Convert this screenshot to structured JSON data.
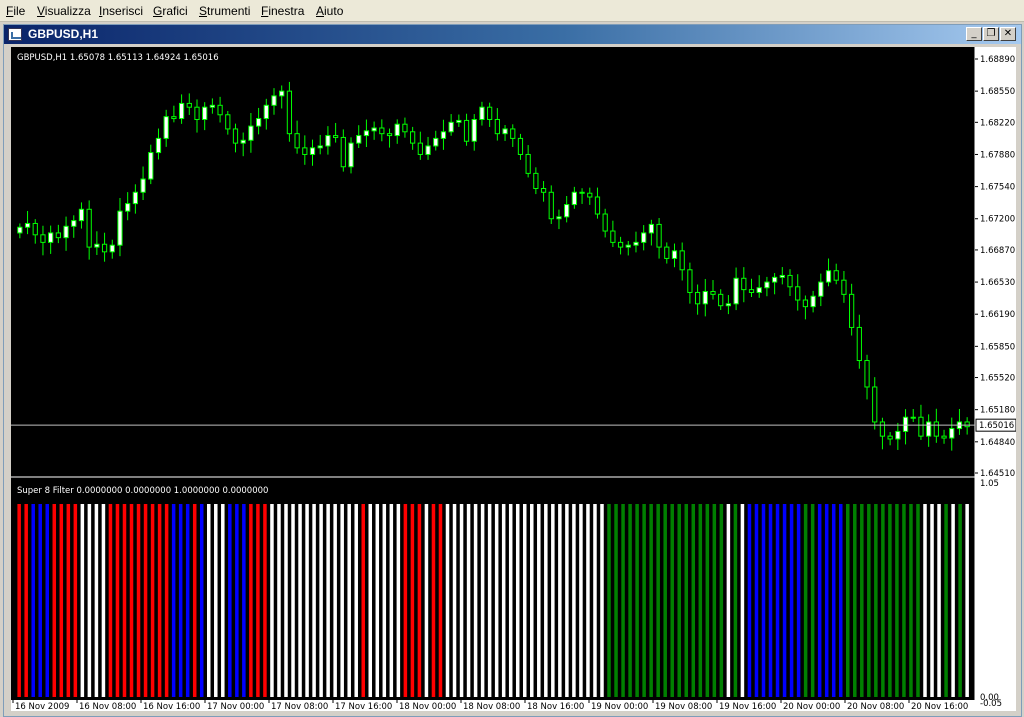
{
  "menu": {
    "items": [
      {
        "label": "File",
        "underline": "F",
        "rest": "ile"
      },
      {
        "label": "Visualizza",
        "underline": "V",
        "rest": "isualizza"
      },
      {
        "label": "Inserisci",
        "underline": "I",
        "rest": "nserisci"
      },
      {
        "label": "Grafici",
        "underline": "G",
        "rest": "rafici"
      },
      {
        "label": "Strumenti",
        "underline": "S",
        "rest": "trumenti"
      },
      {
        "label": "Finestra",
        "underline": "F",
        "rest": "inestra"
      },
      {
        "label": "Aiuto",
        "underline": "A",
        "rest": "iuto"
      }
    ]
  },
  "window": {
    "title": "GBPUSD,H1",
    "minimize_glyph": "_",
    "restore_glyph": "❐",
    "close_glyph": "✕"
  },
  "colors": {
    "chart_bg": "#000000",
    "candle_bull": "#ffffff",
    "candle_bear": "#000000",
    "candle_outline": "#00ff00",
    "ind_red": "#ff0000",
    "ind_blue": "#0000ff",
    "ind_white": "#ffffff",
    "ind_green": "#008000",
    "price_line": "#c0c0c0",
    "axis_panel": "#ffffff"
  },
  "chart_data": [
    {
      "type": "candlestick",
      "title": "GBPUSD,H1",
      "ohlc_header": "GBPUSD,H1  1.65078 1.65113 1.64924 1.65016",
      "y_ticks": [
        "1.68890",
        "1.68550",
        "1.68220",
        "1.67880",
        "1.67540",
        "1.67200",
        "1.66870",
        "1.66530",
        "1.66190",
        "1.65850",
        "1.65520",
        "1.65180",
        "1.64840",
        "1.64510"
      ],
      "ylim": [
        1.6451,
        1.6889
      ],
      "current_price": "1.65016",
      "x_tick_labels": [
        "16 Nov 2009",
        "16 Nov 08:00",
        "16 Nov 16:00",
        "17 Nov 00:00",
        "17 Nov 08:00",
        "17 Nov 16:00",
        "18 Nov 00:00",
        "18 Nov 08:00",
        "18 Nov 16:00",
        "19 Nov 00:00",
        "19 Nov 08:00",
        "19 Nov 16:00",
        "20 Nov 00:00",
        "20 Nov 08:00",
        "20 Nov 16:00"
      ],
      "close": [
        1.6711,
        1.6715,
        1.6703,
        1.6695,
        1.6705,
        1.67,
        1.6712,
        1.6718,
        1.673,
        1.669,
        1.6693,
        1.6685,
        1.6692,
        1.6728,
        1.6736,
        1.6748,
        1.6762,
        1.679,
        1.6805,
        1.6828,
        1.6826,
        1.6842,
        1.6838,
        1.6825,
        1.6838,
        1.684,
        1.683,
        1.6815,
        1.68,
        1.6803,
        1.6818,
        1.6826,
        1.684,
        1.685,
        1.6855,
        1.681,
        1.6795,
        1.6788,
        1.6795,
        1.6797,
        1.6808,
        1.6806,
        1.6775,
        1.68,
        1.6808,
        1.6813,
        1.6816,
        1.681,
        1.6808,
        1.682,
        1.6812,
        1.68,
        1.6788,
        1.6797,
        1.6805,
        1.6812,
        1.6822,
        1.6824,
        1.6802,
        1.6825,
        1.6838,
        1.6825,
        1.681,
        1.6815,
        1.6805,
        1.6788,
        1.6768,
        1.6752,
        1.6748,
        1.672,
        1.6722,
        1.6735,
        1.6748,
        1.6747,
        1.6743,
        1.6725,
        1.6707,
        1.6695,
        1.669,
        1.6692,
        1.6695,
        1.6705,
        1.6714,
        1.669,
        1.6678,
        1.6686,
        1.6666,
        1.6642,
        1.663,
        1.6643,
        1.664,
        1.6628,
        1.663,
        1.6657,
        1.6645,
        1.6642,
        1.6647,
        1.6653,
        1.6658,
        1.666,
        1.6648,
        1.6634,
        1.6627,
        1.6638,
        1.6653,
        1.6665,
        1.6655,
        1.664,
        1.6605,
        1.657,
        1.6542,
        1.6505,
        1.649,
        1.6487,
        1.6495,
        1.651,
        1.651,
        1.649,
        1.6505,
        1.649,
        1.6488,
        1.6498,
        1.6505,
        1.65
      ],
      "open_offsets_note": "",
      "indicator": {
        "label": "Super 8 Filter 0.0000000 0.0000000 1.0000000 0.0000000",
        "y_ticks": [
          "1.05",
          "0.00",
          "-0.05"
        ],
        "bar_colors": [
          "red",
          "red",
          "blue",
          "blue",
          "blue",
          "red",
          "red",
          "red",
          "red",
          "white",
          "white",
          "white",
          "white",
          "red",
          "red",
          "red",
          "red",
          "red",
          "red",
          "red",
          "red",
          "red",
          "blue",
          "blue",
          "blue",
          "red",
          "blue",
          "white",
          "white",
          "white",
          "blue",
          "blue",
          "blue",
          "red",
          "red",
          "red",
          "white",
          "white",
          "white",
          "white",
          "white",
          "white",
          "white",
          "white",
          "white",
          "white",
          "white",
          "white",
          "white",
          "red",
          "white",
          "white",
          "white",
          "white",
          "white",
          "red",
          "red",
          "red",
          "white",
          "red",
          "red",
          "white",
          "white",
          "white",
          "white",
          "white",
          "white",
          "white",
          "white",
          "white",
          "white",
          "white",
          "white",
          "white",
          "white",
          "white",
          "white",
          "white",
          "white",
          "white",
          "white",
          "white",
          "white",
          "white",
          "green",
          "green",
          "green",
          "green",
          "green",
          "green",
          "green",
          "green",
          "green",
          "green",
          "green",
          "green",
          "green",
          "green",
          "green",
          "green",
          "green",
          "white",
          "green",
          "white",
          "blue",
          "blue",
          "blue",
          "blue",
          "blue",
          "blue",
          "blue",
          "blue",
          "green",
          "green",
          "blue",
          "blue",
          "blue",
          "blue",
          "green",
          "green",
          "green",
          "green",
          "green",
          "green",
          "green",
          "green",
          "green",
          "green",
          "green",
          "white",
          "white",
          "white",
          "green",
          "white",
          "green",
          "white"
        ]
      }
    }
  ]
}
